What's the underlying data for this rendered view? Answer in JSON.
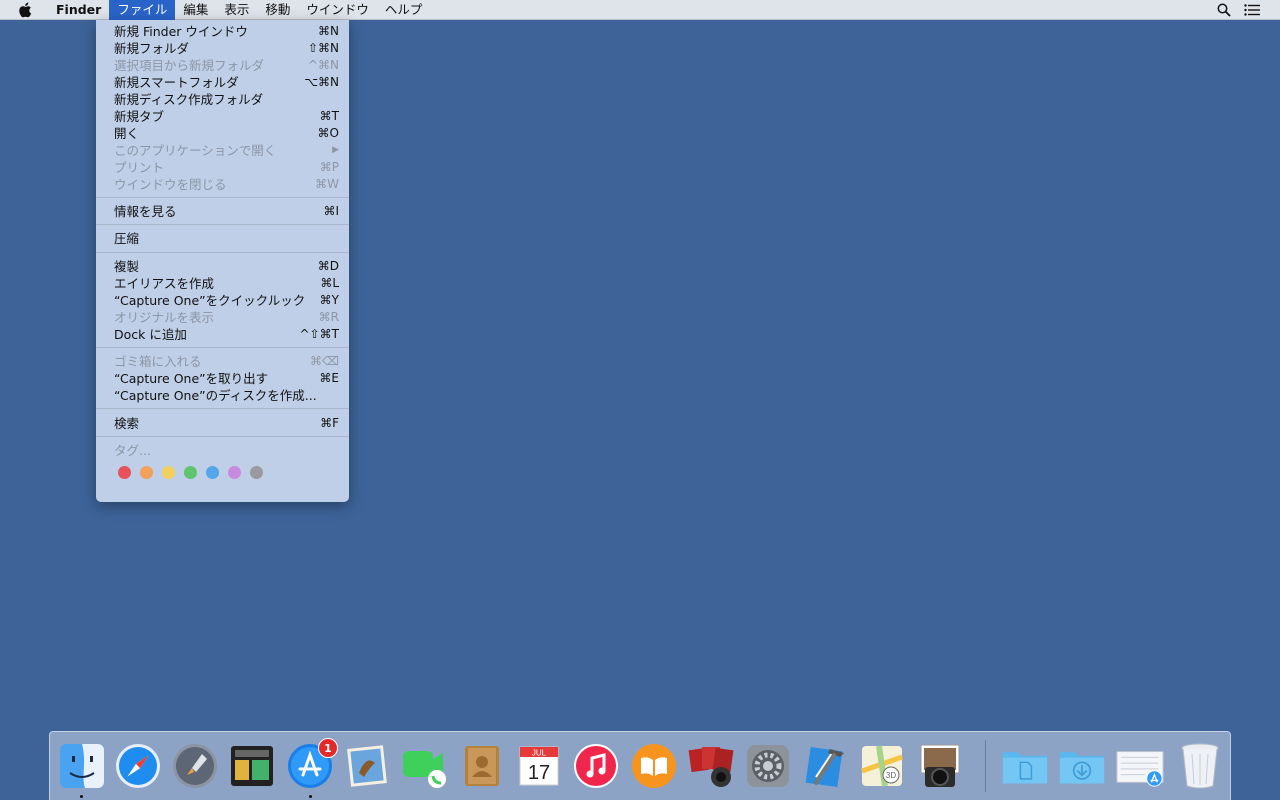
{
  "menubar": {
    "app_name": "Finder",
    "menus": [
      "ファイル",
      "編集",
      "表示",
      "移動",
      "ウインドウ",
      "ヘルプ"
    ],
    "active_menu_index": 0
  },
  "file_menu": {
    "items": [
      {
        "label": "新規 Finder ウインドウ",
        "shortcut": "⌘N",
        "enabled": true
      },
      {
        "label": "新規フォルダ",
        "shortcut": "⇧⌘N",
        "enabled": true
      },
      {
        "label": "選択項目から新規フォルダ",
        "shortcut": "^⌘N",
        "enabled": false
      },
      {
        "label": "新規スマートフォルダ",
        "shortcut": "⌥⌘N",
        "enabled": true
      },
      {
        "label": "新規ディスク作成フォルダ",
        "shortcut": "",
        "enabled": true
      },
      {
        "label": "新規タブ",
        "shortcut": "⌘T",
        "enabled": true
      },
      {
        "label": "開く",
        "shortcut": "⌘O",
        "enabled": true
      },
      {
        "label": "このアプリケーションで開く",
        "shortcut": "▶",
        "enabled": false
      },
      {
        "label": "プリント",
        "shortcut": "⌘P",
        "enabled": false
      },
      {
        "label": "ウインドウを閉じる",
        "shortcut": "⌘W",
        "enabled": false
      },
      {
        "label": "情報を見る",
        "shortcut": "⌘I",
        "enabled": true
      },
      {
        "label": "圧縮",
        "shortcut": "",
        "enabled": true
      },
      {
        "label": "複製",
        "shortcut": "⌘D",
        "enabled": true
      },
      {
        "label": "エイリアスを作成",
        "shortcut": "⌘L",
        "enabled": true
      },
      {
        "label": "“Capture One”をクイックルック",
        "shortcut": "⌘Y",
        "enabled": true
      },
      {
        "label": "オリジナルを表示",
        "shortcut": "⌘R",
        "enabled": false
      },
      {
        "label": "Dock に追加",
        "shortcut": "^⇧⌘T",
        "enabled": true
      },
      {
        "label": "ゴミ箱に入れる",
        "shortcut": "⌘⌫",
        "enabled": false
      },
      {
        "label": "“Capture One”を取り出す",
        "shortcut": "⌘E",
        "enabled": true
      },
      {
        "label": "“Capture One”のディスクを作成...",
        "shortcut": "",
        "enabled": true
      },
      {
        "label": "検索",
        "shortcut": "⌘F",
        "enabled": true
      },
      {
        "label": "タグ...",
        "shortcut": "",
        "enabled": false
      }
    ],
    "tag_colors": [
      "#e6515a",
      "#f2a05c",
      "#f3cf5b",
      "#5fc46b",
      "#53a6ea",
      "#c88ae0",
      "#9a9a9e"
    ]
  },
  "dock": {
    "apps": [
      {
        "name": "finder-icon",
        "running": true
      },
      {
        "name": "safari-icon",
        "running": false
      },
      {
        "name": "launchpad-icon",
        "running": false
      },
      {
        "name": "mission-control-icon",
        "running": false
      },
      {
        "name": "app-store-icon",
        "running": true,
        "badge": "1"
      },
      {
        "name": "mail-icon",
        "running": false
      },
      {
        "name": "facetime-icon",
        "running": false
      },
      {
        "name": "contacts-icon",
        "running": false
      },
      {
        "name": "calendar-icon",
        "running": false,
        "month": "JUL",
        "day": "17"
      },
      {
        "name": "itunes-icon",
        "running": false
      },
      {
        "name": "ibooks-icon",
        "running": false
      },
      {
        "name": "photo-booth-icon",
        "running": false
      },
      {
        "name": "system-preferences-icon",
        "running": false
      },
      {
        "name": "xcode-icon",
        "running": false
      },
      {
        "name": "maps-icon",
        "running": false
      },
      {
        "name": "capture-one-icon",
        "running": false
      },
      {
        "name": "documents-folder-icon",
        "running": false
      },
      {
        "name": "downloads-folder-icon",
        "running": false
      },
      {
        "name": "app-store-downloads-icon",
        "running": false
      },
      {
        "name": "trash-icon",
        "running": false
      }
    ]
  }
}
